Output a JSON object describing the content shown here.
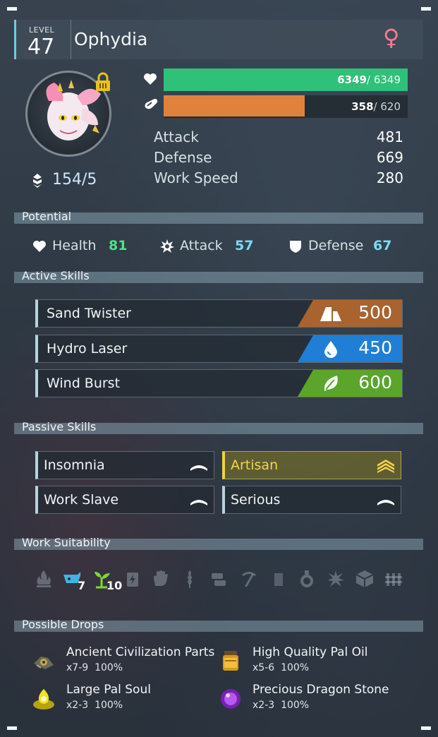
{
  "pal": {
    "level_label": "LEVEL",
    "level": "47",
    "name": "Ophydia",
    "gender_symbol": "♀",
    "rank": "154/5"
  },
  "bars": {
    "hp": {
      "current": "6349",
      "max": "/ 6349",
      "fraction": 1.0
    },
    "sp": {
      "current": "358",
      "max": "/ 620",
      "fraction": 0.5774
    }
  },
  "stats": [
    {
      "label": "Attack",
      "value": "481"
    },
    {
      "label": "Defense",
      "value": "669"
    },
    {
      "label": "Work Speed",
      "value": "280"
    }
  ],
  "sections": {
    "potential": "Potential",
    "active": "Active Skills",
    "passive": "Passive Skills",
    "work": "Work Suitability",
    "drops": "Possible Drops"
  },
  "potential": [
    {
      "label": "Health",
      "value": "81",
      "color": "#4fe08a",
      "icon": "heart-icon"
    },
    {
      "label": "Attack",
      "value": "57",
      "color": "#7fd8f0",
      "icon": "attack-burst-icon"
    },
    {
      "label": "Defense",
      "value": "67",
      "color": "#7fd8f0",
      "icon": "shield-icon"
    }
  ],
  "active_skills": [
    {
      "name": "Sand Twister",
      "power": "500",
      "element": "ground",
      "color": "#a8632e",
      "icon": "ground-element-icon"
    },
    {
      "name": "Hydro Laser",
      "power": "450",
      "element": "water",
      "color": "#1f7fd6",
      "icon": "water-element-icon"
    },
    {
      "name": "Wind Burst",
      "power": "600",
      "element": "grass",
      "color": "#5aa52a",
      "icon": "grass-element-icon"
    }
  ],
  "passive_skills": [
    {
      "name": "Insomnia",
      "rank": "single",
      "gold": false
    },
    {
      "name": "Artisan",
      "rank": "triple",
      "gold": true
    },
    {
      "name": "Work Slave",
      "rank": "single",
      "gold": false
    },
    {
      "name": "Serious",
      "rank": "single",
      "gold": false
    }
  ],
  "work": [
    {
      "icon": "kindling-icon",
      "active": false,
      "level": ""
    },
    {
      "icon": "watering-icon",
      "active": true,
      "level": "7",
      "color": "#3fb4e8"
    },
    {
      "icon": "planting-icon",
      "active": true,
      "level": "10",
      "color": "#7fd63a"
    },
    {
      "icon": "generating-electricity-icon",
      "active": false,
      "level": ""
    },
    {
      "icon": "handiwork-icon",
      "active": false,
      "level": ""
    },
    {
      "icon": "gathering-icon",
      "active": false,
      "level": ""
    },
    {
      "icon": "lumbering-icon",
      "active": false,
      "level": ""
    },
    {
      "icon": "mining-icon",
      "active": false,
      "level": ""
    },
    {
      "icon": "oil-extraction-icon",
      "active": false,
      "level": ""
    },
    {
      "icon": "medicine-production-icon",
      "active": false,
      "level": ""
    },
    {
      "icon": "cooling-icon",
      "active": false,
      "level": ""
    },
    {
      "icon": "transporting-icon",
      "active": false,
      "level": ""
    },
    {
      "icon": "farming-icon",
      "active": false,
      "level": ""
    }
  ],
  "drops": [
    {
      "name": "Ancient Civilization Parts",
      "qty": "x7-9",
      "chance": "100%",
      "icon": "ancient-parts-icon"
    },
    {
      "name": "High Quality Pal Oil",
      "qty": "x5-6",
      "chance": "100%",
      "icon": "pal-oil-icon"
    },
    {
      "name": "Large Pal Soul",
      "qty": "x2-3",
      "chance": "100%",
      "icon": "pal-soul-icon"
    },
    {
      "name": "Precious Dragon Stone",
      "qty": "x2-3",
      "chance": "100%",
      "icon": "dragon-stone-icon"
    }
  ]
}
